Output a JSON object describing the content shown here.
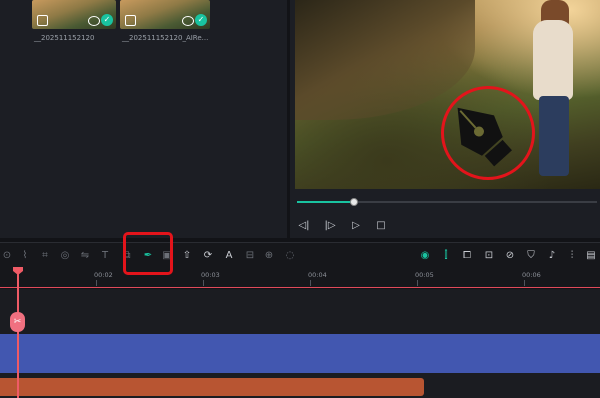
{
  "media": {
    "items": [
      {
        "label": "__202511152120",
        "check": "✓"
      },
      {
        "label": "__202511152120_AIRe...",
        "check": "✓"
      }
    ]
  },
  "preview": {
    "progress": 0.18,
    "controls": [
      "prev-frame-icon",
      "next-frame-icon",
      "play-icon",
      "stop-icon"
    ],
    "control_glyphs": {
      "prev": "◁|",
      "next": "|▷",
      "play": "▷",
      "stop": "□"
    }
  },
  "toolbar": {
    "tools_left": [
      "zoom-icon",
      "crop-icon",
      "crop-box-icon",
      "mask-icon",
      "audio-adjust-icon",
      "text-icon",
      "sticker-icon",
      "pen-tool-icon",
      "freeze-icon",
      "export-frame-icon",
      "auto-reframe-icon",
      "translate-icon",
      "speed-icon",
      "split-icon",
      "audio-ducking-icon",
      "stabilize-icon"
    ],
    "tools_right": [
      "ai-assistant-icon",
      "snap-icon",
      "link-icon",
      "marker-icon",
      "color-icon",
      "shield-icon",
      "mic-icon",
      "mixer-icon",
      "preview-quality-icon"
    ],
    "accent": "#19c3a0",
    "highlight_color": "#e3141b"
  },
  "ruler": {
    "ticks": [
      "00:02",
      "00:03",
      "00:04",
      "00:05",
      "00:06"
    ]
  },
  "timeline": {
    "video_clip_color": "#4257b0",
    "audio_clip_color": "#b85532",
    "playhead_color": "#ef5b66",
    "cut_glyph": "✂"
  }
}
